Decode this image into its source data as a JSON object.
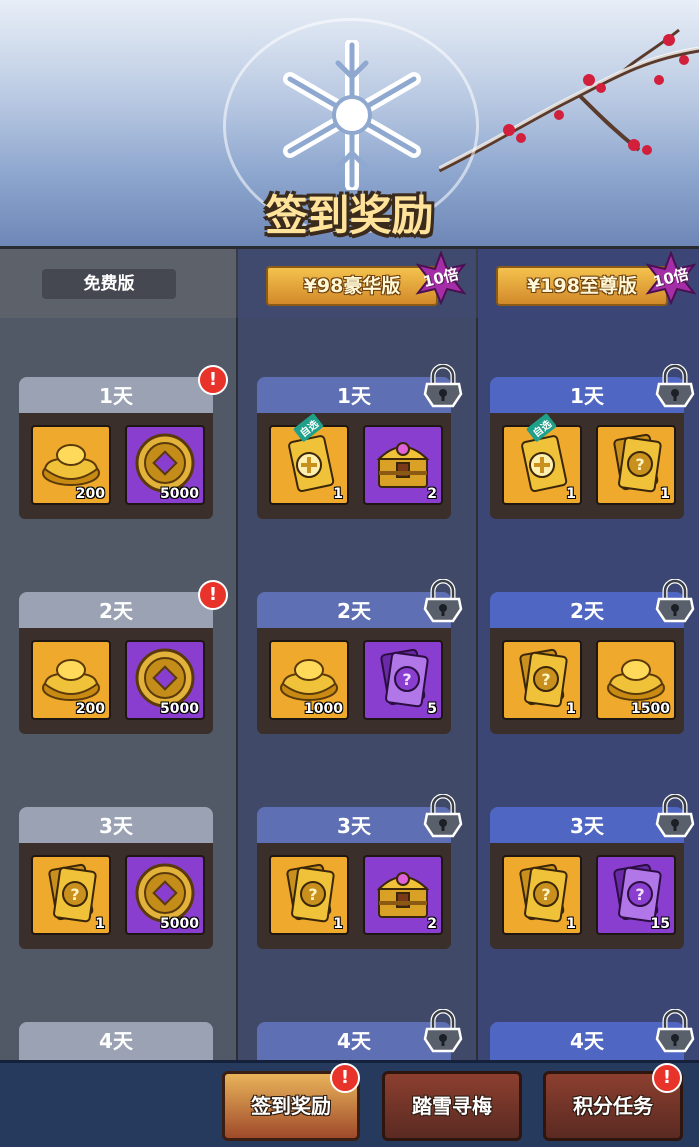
{
  "header": {
    "title": "签到奖励"
  },
  "tiers": [
    {
      "label": "免费版"
    },
    {
      "label": "¥98豪华版",
      "badge": "10倍"
    },
    {
      "label": "¥198至尊版",
      "badge": "10倍"
    }
  ],
  "columns": {
    "free": [
      {
        "day": "1天",
        "items": [
          {
            "icon": "gold-ingot-icon",
            "qty": "200"
          },
          {
            "icon": "copper-coin-icon",
            "qty": "5000"
          }
        ]
      },
      {
        "day": "2天",
        "items": [
          {
            "icon": "gold-ingot-icon",
            "qty": "200"
          },
          {
            "icon": "copper-coin-icon",
            "qty": "5000"
          }
        ]
      },
      {
        "day": "3天",
        "items": [
          {
            "icon": "gold-card-icon",
            "qty": "1"
          },
          {
            "icon": "copper-coin-icon",
            "qty": "5000"
          }
        ]
      },
      {
        "day": "4天"
      }
    ],
    "deluxe": [
      {
        "day": "1天",
        "items": [
          {
            "icon": "choose-card-icon",
            "qty": "1",
            "tag": "自选"
          },
          {
            "icon": "treasure-chest-icon",
            "qty": "2"
          }
        ]
      },
      {
        "day": "2天",
        "items": [
          {
            "icon": "gold-ingot-icon",
            "qty": "1000"
          },
          {
            "icon": "purple-card-icon",
            "qty": "5"
          }
        ]
      },
      {
        "day": "3天",
        "items": [
          {
            "icon": "gold-card-icon",
            "qty": "1"
          },
          {
            "icon": "treasure-chest-icon",
            "qty": "2"
          }
        ]
      },
      {
        "day": "4天"
      }
    ],
    "supreme": [
      {
        "day": "1天",
        "items": [
          {
            "icon": "choose-card-icon",
            "qty": "1",
            "tag": "自选"
          },
          {
            "icon": "gold-card-icon",
            "qty": "1"
          }
        ]
      },
      {
        "day": "2天",
        "items": [
          {
            "icon": "gold-card-icon",
            "qty": "1"
          },
          {
            "icon": "gold-ingot-icon",
            "qty": "1500"
          }
        ]
      },
      {
        "day": "3天",
        "items": [
          {
            "icon": "gold-card-icon",
            "qty": "1"
          },
          {
            "icon": "purple-card-icon",
            "qty": "15"
          }
        ]
      },
      {
        "day": "4天"
      }
    ]
  },
  "bottom_nav": [
    {
      "label": "签到奖励",
      "active": true,
      "alert": "!"
    },
    {
      "label": "踏雪寻梅",
      "active": false
    },
    {
      "label": "积分任务",
      "active": false,
      "alert": "!"
    }
  ],
  "colors": {
    "gold_slot": "#efa92c",
    "purple_slot": "#8a3ed0",
    "alert_red": "#e8332a"
  }
}
